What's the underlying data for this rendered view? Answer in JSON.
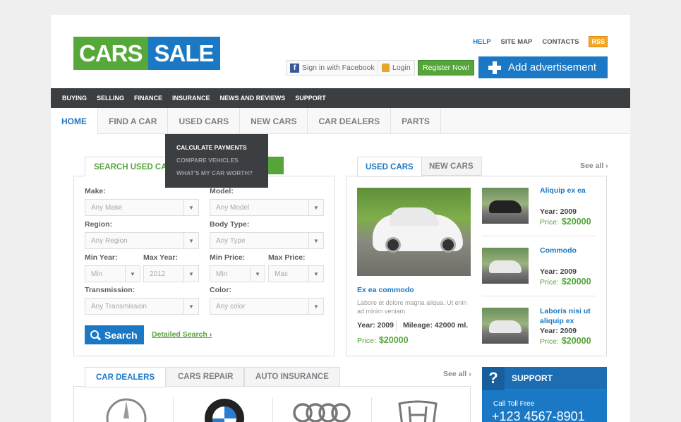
{
  "logo": {
    "part1": "CARS",
    "part2": "SALE"
  },
  "top_links": {
    "help": "HELP",
    "site_map": "SITE MAP",
    "contacts": "CONTACTS",
    "rss": "RSS"
  },
  "account": {
    "facebook": "Sign in with Facebook",
    "login": "Login",
    "register": "Register Now!",
    "add_ad": "Add advertisement"
  },
  "top_nav": [
    "BUYING",
    "SELLING",
    "FINANCE",
    "INSURANCE",
    "NEWS AND REVIEWS",
    "SUPPORT"
  ],
  "main_nav": [
    "HOME",
    "FIND A CAR",
    "USED CARS",
    "NEW CARS",
    "CAR DEALERS",
    "PARTS"
  ],
  "dropdown": [
    "CALCULATE PAYMENTS",
    "COMPARE VEHICLES",
    "WHAT'S MY CAR WORTH?"
  ],
  "search": {
    "tab_active": "SEARCH USED CARS",
    "tab_other": "S",
    "labels": {
      "make": "Make:",
      "model": "Model:",
      "region": "Region:",
      "body_type": "Body Type:",
      "min_year": "Min Year:",
      "max_year": "Max Year:",
      "min_price": "Min Price:",
      "max_price": "Max Price:",
      "transmission": "Transmission:",
      "color": "Color:"
    },
    "values": {
      "make": "Any Make",
      "model": "Any Model",
      "region": "Any Region",
      "body_type": "Any Type",
      "min_year": "Min",
      "max_year": "2012",
      "min_price": "Min",
      "max_price": "Max",
      "transmission": "Any Transmission",
      "color": "Any color"
    },
    "button": "Search",
    "detailed": "Detailed Search",
    "chevron": "›"
  },
  "cars": {
    "tabs": [
      "USED CARS",
      "NEW CARS"
    ],
    "see_all": "See all",
    "chevron": "›",
    "featured": {
      "title": "Ex ea commodo",
      "desc": "Labore et dolore magna aliqua. Ut enin ad minim veniam",
      "year": "Year: 2009",
      "mileage": "Mileage: 42000 ml.",
      "price_label": "Price:",
      "price": "$20000"
    },
    "list": [
      {
        "title": "Aliquip ex ea",
        "title2": "",
        "year": "Year: 2009",
        "price_label": "Price:",
        "price": "$20000"
      },
      {
        "title": "Commodo",
        "title2": "",
        "year": "Year: 2009",
        "price_label": "Price:",
        "price": "$20000"
      },
      {
        "title": "Laboris nisi ut",
        "title2": "aliquip ex",
        "year": "Year: 2009",
        "price_label": "Price:",
        "price": "$20000"
      }
    ]
  },
  "bottom": {
    "tabs": [
      "CAR DEALERS",
      "CARS REPAIR",
      "AUTO INSURANCE"
    ],
    "see_all": "See all",
    "chevron": "›",
    "brands": [
      "mercedes-logo",
      "bmw-logo",
      "audi-logo",
      "honda-logo"
    ]
  },
  "support": {
    "title": "SUPPORT",
    "icon": "?",
    "call_label": "Call Toll Free",
    "phone": "+123 4567-8901"
  },
  "colors": {
    "green": "#55a53a",
    "blue": "#1b78c4",
    "dark": "#3c3f42"
  }
}
